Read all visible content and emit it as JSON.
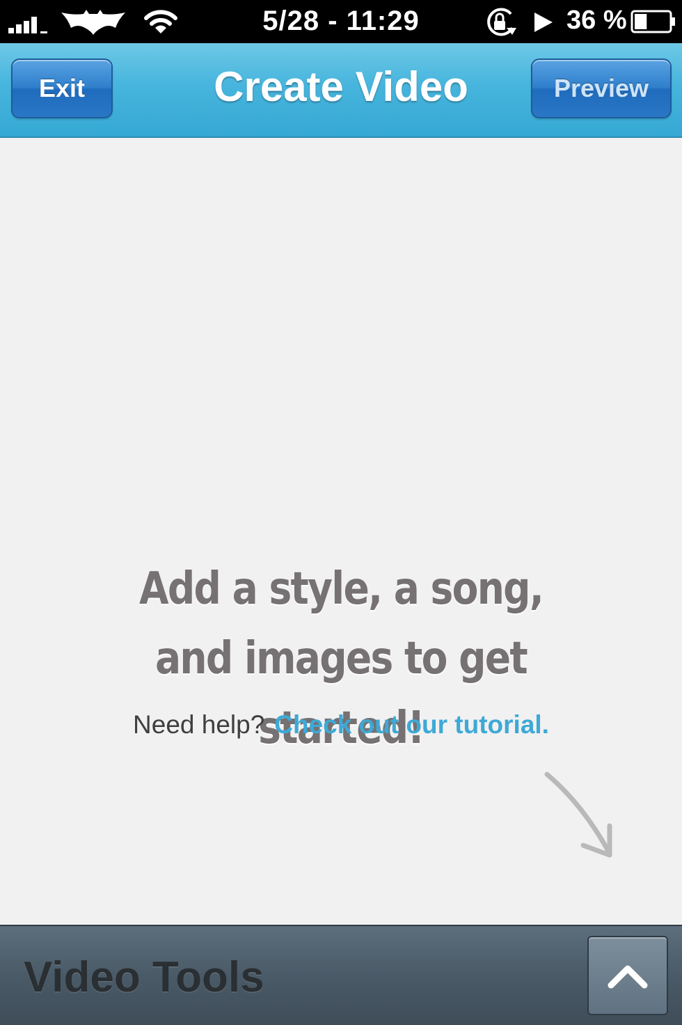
{
  "status_bar": {
    "time": "5/28 - 11:29",
    "battery_percent": "36 %",
    "battery_level": 0.36,
    "icons": [
      "signal-strength-icon",
      "carrier-logo-icon",
      "wifi-icon",
      "rotation-lock-icon",
      "play-icon",
      "battery-icon"
    ]
  },
  "nav": {
    "title": "Create Video",
    "exit_label": "Exit",
    "preview_label": "Preview"
  },
  "main": {
    "headline_line1": "Add a style, a song,",
    "headline_line2": "and images to get started!",
    "help_text": "Need help?",
    "help_link": "Check out our tutorial."
  },
  "toolbar": {
    "title": "Video Tools",
    "expand_icon": "chevron-up-icon"
  },
  "colors": {
    "nav_blue": "#47b5dd",
    "button_blue": "#2f7fcc",
    "link_blue": "#3ea9d6",
    "toolbar_slate": "#4a5a67"
  }
}
